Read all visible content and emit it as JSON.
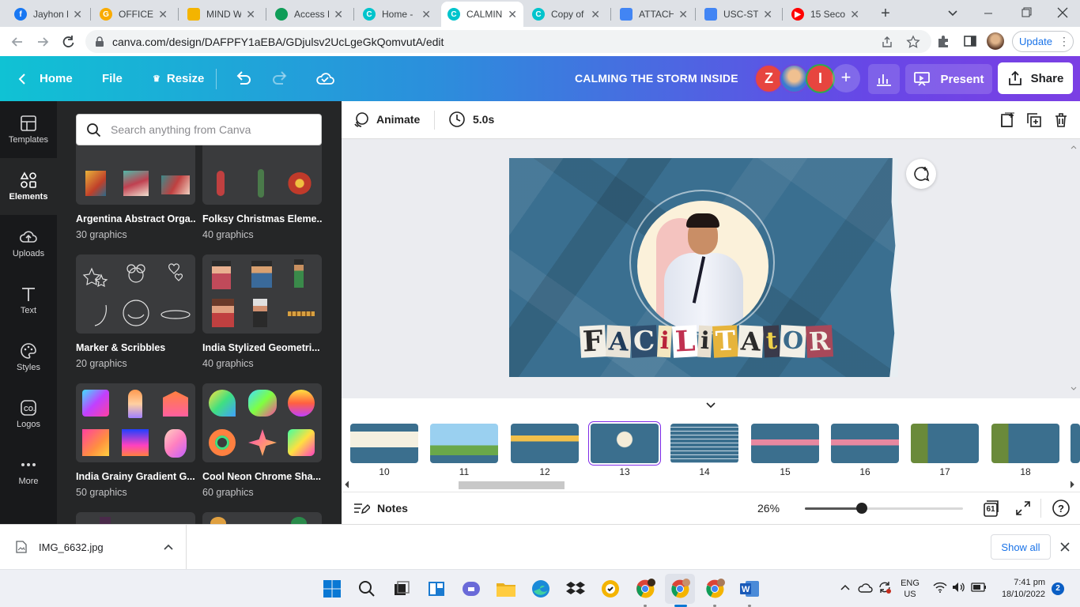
{
  "browser": {
    "tabs": [
      {
        "title": "Jayhon M",
        "color": "#1877f2",
        "glyph": "f"
      },
      {
        "title": "OFFICER",
        "color": "#f9ab00",
        "glyph": "G"
      },
      {
        "title": "MIND W",
        "color": "#f4b400",
        "glyph": ""
      },
      {
        "title": "Access D",
        "color": "#0f9d58",
        "glyph": ""
      },
      {
        "title": "Home -",
        "color": "#00c4cc",
        "glyph": "C"
      },
      {
        "title": "CALMIN",
        "color": "#00c4cc",
        "glyph": "C"
      },
      {
        "title": "Copy of",
        "color": "#00c4cc",
        "glyph": "C"
      },
      {
        "title": "ATTACH",
        "color": "#4285f4",
        "glyph": ""
      },
      {
        "title": "USC-STU",
        "color": "#4285f4",
        "glyph": ""
      },
      {
        "title": "15 Seco",
        "color": "#ff0000",
        "glyph": "▶"
      }
    ],
    "url": "canva.com/design/DAFPFY1aEBA/GDjulsv2UcLgeGkQomvutA/edit",
    "update_label": "Update"
  },
  "canva": {
    "home_label": "Home",
    "file_label": "File",
    "resize_label": "Resize",
    "design_title": "CALMING THE STORM INSIDE",
    "avatars": [
      {
        "initial": "Z",
        "color": "#e7453f"
      },
      {
        "initial": "",
        "color": "#d9a066"
      },
      {
        "initial": "I",
        "color": "#e7453f"
      }
    ],
    "present_label": "Present",
    "share_label": "Share",
    "rail": [
      {
        "label": "Templates",
        "icon": "templates-icon"
      },
      {
        "label": "Elements",
        "icon": "elements-icon"
      },
      {
        "label": "Uploads",
        "icon": "uploads-icon"
      },
      {
        "label": "Text",
        "icon": "text-icon"
      },
      {
        "label": "Styles",
        "icon": "styles-icon"
      },
      {
        "label": "Logos",
        "icon": "logos-icon"
      },
      {
        "label": "More",
        "icon": "more-icon"
      }
    ],
    "search_placeholder": "Search anything from Canva",
    "collections": [
      {
        "title": "Argentina Abstract Orga...",
        "count": "30 graphics"
      },
      {
        "title": "Folksy Christmas Eleme...",
        "count": "40 graphics"
      },
      {
        "title": "Marker & Scribbles",
        "count": "20 graphics"
      },
      {
        "title": "India Stylized Geometri...",
        "count": "40 graphics"
      },
      {
        "title": "India Grainy Gradient G...",
        "count": "50 graphics"
      },
      {
        "title": "Cool Neon Chrome Sha...",
        "count": "60 graphics"
      }
    ],
    "toolbar": {
      "animate_label": "Animate",
      "duration_label": "5.0s"
    },
    "slide_letters": [
      "F",
      "A",
      "C",
      "i",
      "L",
      "i",
      "T",
      "A",
      "t",
      "O",
      "R"
    ],
    "pages": [
      "10",
      "11",
      "12",
      "13",
      "14",
      "15",
      "16",
      "17",
      "18"
    ],
    "active_page": "13",
    "notes_label": "Notes",
    "zoom_label": "26%",
    "zoom_fraction": 0.26,
    "page_count": "61"
  },
  "downloads": {
    "file": "IMG_6632.jpg",
    "show_all_label": "Show all"
  },
  "taskbar": {
    "lang": "ENG",
    "region": "US",
    "time": "7:41 pm",
    "date": "18/10/2022",
    "badge": "2"
  }
}
